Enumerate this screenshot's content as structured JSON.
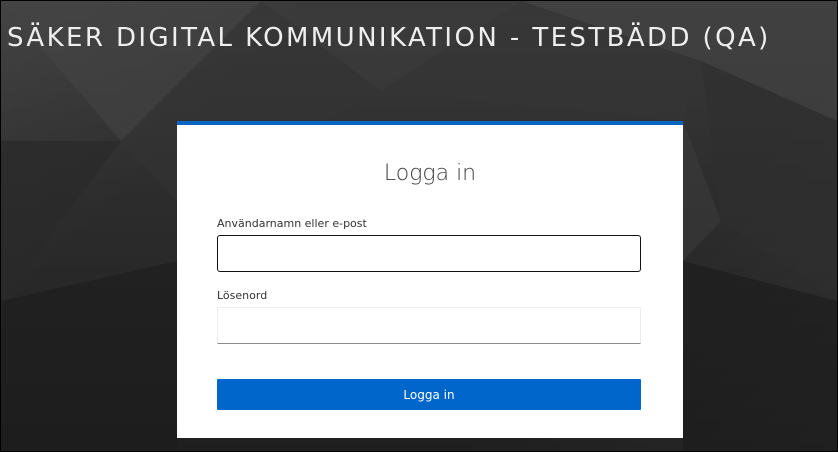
{
  "header": {
    "title": "SÄKER DIGITAL KOMMUNIKATION - TESTBÄDD (QA)"
  },
  "login": {
    "title": "Logga in",
    "username_label": "Användarnamn eller e-post",
    "username_value": "",
    "password_label": "Lösenord",
    "password_value": "",
    "submit_label": "Logga in"
  },
  "colors": {
    "accent": "#0066cc",
    "card_top_border": "#0a66c2",
    "background": "#2c2c2c",
    "title_text": "#eeeeee"
  }
}
